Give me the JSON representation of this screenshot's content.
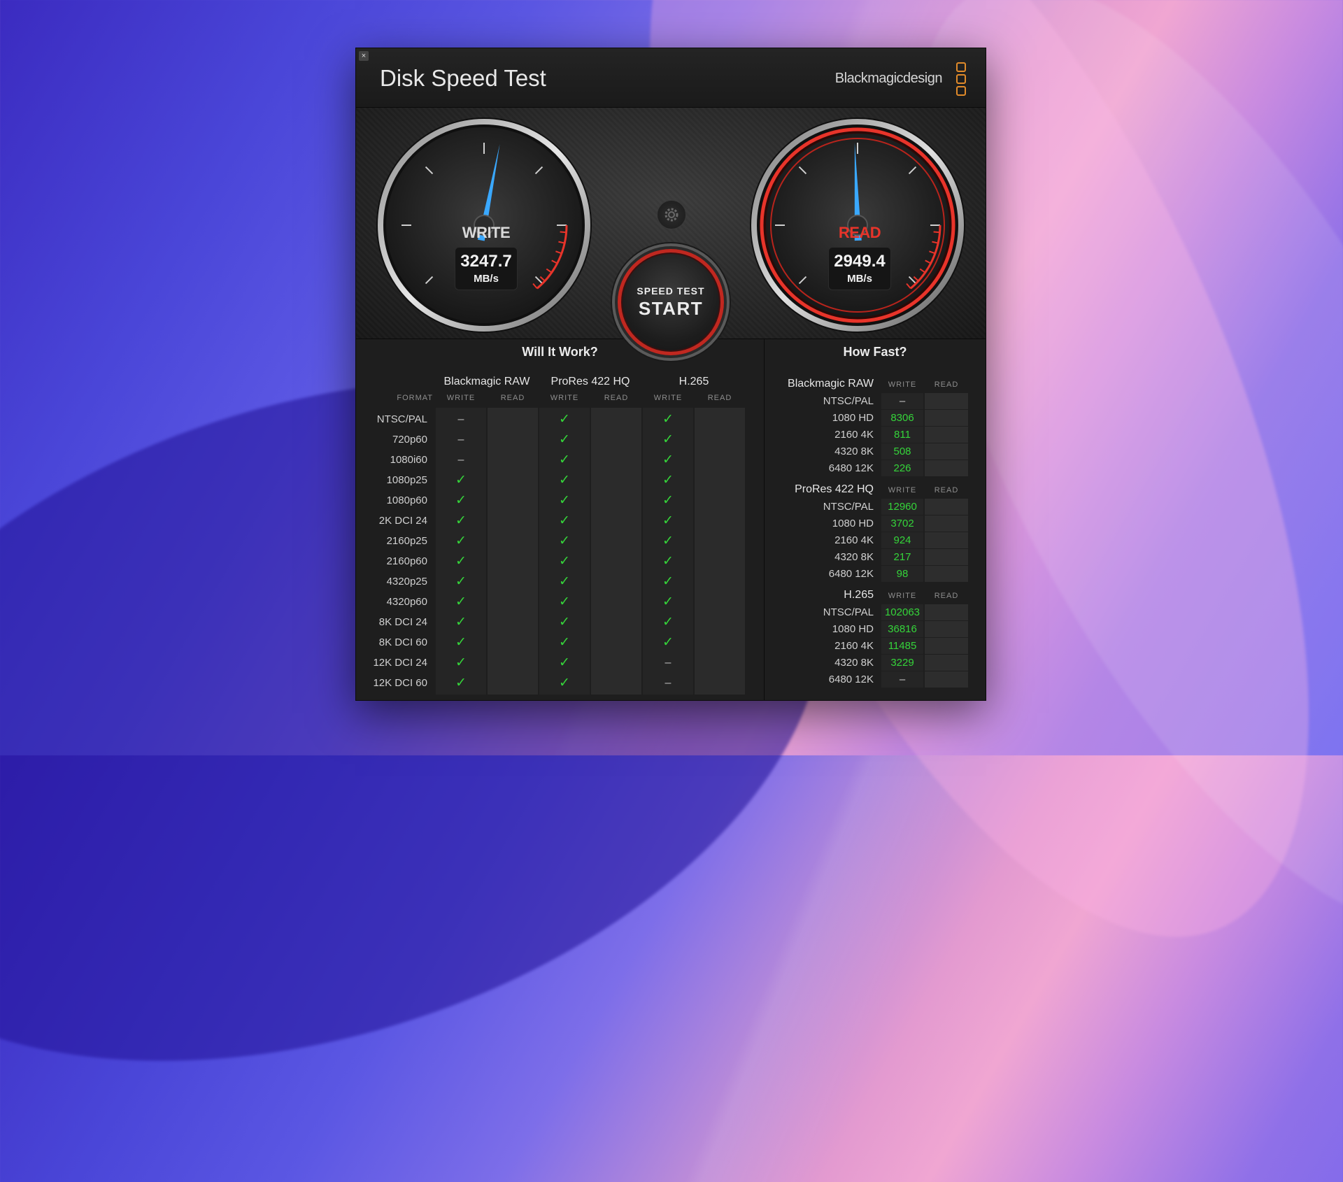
{
  "app": {
    "title": "Disk Speed Test",
    "brand": "Blackmagicdesign",
    "close_glyph": "×"
  },
  "gauges": {
    "write": {
      "label": "WRITE",
      "value": "3247.7",
      "unit": "MB/s"
    },
    "read": {
      "label": "READ",
      "value": "2949.4",
      "unit": "MB/s"
    }
  },
  "start_button": {
    "top": "SPEED TEST",
    "main": "START"
  },
  "icons": {
    "settings": "gear-icon",
    "close": "close-icon",
    "check": "checkmark-icon"
  },
  "colors": {
    "accent_red": "#e8342a",
    "check_green": "#35d43a",
    "needle_blue": "#3aa8ff",
    "brand_orange": "#e08a2a"
  },
  "will_it_work": {
    "title": "Will It Work?",
    "format_header": "FORMAT",
    "write_label": "WRITE",
    "read_label": "READ",
    "codecs": [
      "Blackmagic RAW",
      "ProRes 422 HQ",
      "H.265"
    ],
    "rows": [
      {
        "format": "NTSC/PAL",
        "values": [
          "–",
          "✓",
          "✓"
        ]
      },
      {
        "format": "720p60",
        "values": [
          "–",
          "✓",
          "✓"
        ]
      },
      {
        "format": "1080i60",
        "values": [
          "–",
          "✓",
          "✓"
        ]
      },
      {
        "format": "1080p25",
        "values": [
          "✓",
          "✓",
          "✓"
        ]
      },
      {
        "format": "1080p60",
        "values": [
          "✓",
          "✓",
          "✓"
        ]
      },
      {
        "format": "2K DCI 24",
        "values": [
          "✓",
          "✓",
          "✓"
        ]
      },
      {
        "format": "2160p25",
        "values": [
          "✓",
          "✓",
          "✓"
        ]
      },
      {
        "format": "2160p60",
        "values": [
          "✓",
          "✓",
          "✓"
        ]
      },
      {
        "format": "4320p25",
        "values": [
          "✓",
          "✓",
          "✓"
        ]
      },
      {
        "format": "4320p60",
        "values": [
          "✓",
          "✓",
          "✓"
        ]
      },
      {
        "format": "8K DCI 24",
        "values": [
          "✓",
          "✓",
          "✓"
        ]
      },
      {
        "format": "8K DCI 60",
        "values": [
          "✓",
          "✓",
          "✓"
        ]
      },
      {
        "format": "12K DCI 24",
        "values": [
          "✓",
          "✓",
          "–"
        ]
      },
      {
        "format": "12K DCI 60",
        "values": [
          "✓",
          "✓",
          "–"
        ]
      }
    ]
  },
  "how_fast": {
    "title": "How Fast?",
    "write_label": "WRITE",
    "read_label": "READ",
    "groups": [
      {
        "name": "Blackmagic RAW",
        "rows": [
          {
            "res": "NTSC/PAL",
            "write": "–"
          },
          {
            "res": "1080 HD",
            "write": "8306"
          },
          {
            "res": "2160 4K",
            "write": "811"
          },
          {
            "res": "4320 8K",
            "write": "508"
          },
          {
            "res": "6480 12K",
            "write": "226"
          }
        ]
      },
      {
        "name": "ProRes 422 HQ",
        "rows": [
          {
            "res": "NTSC/PAL",
            "write": "12960"
          },
          {
            "res": "1080 HD",
            "write": "3702"
          },
          {
            "res": "2160 4K",
            "write": "924"
          },
          {
            "res": "4320 8K",
            "write": "217"
          },
          {
            "res": "6480 12K",
            "write": "98"
          }
        ]
      },
      {
        "name": "H.265",
        "rows": [
          {
            "res": "NTSC/PAL",
            "write": "102063"
          },
          {
            "res": "1080 HD",
            "write": "36816"
          },
          {
            "res": "2160 4K",
            "write": "11485"
          },
          {
            "res": "4320 8K",
            "write": "3229"
          },
          {
            "res": "6480 12K",
            "write": "–"
          }
        ]
      }
    ]
  }
}
